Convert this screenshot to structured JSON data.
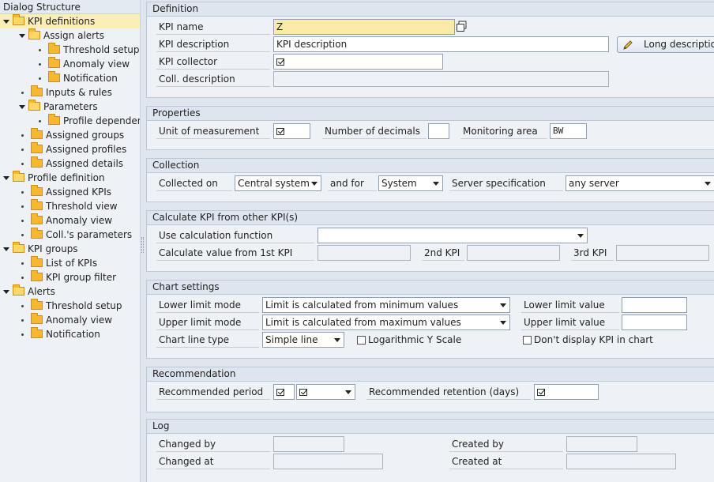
{
  "tree": {
    "title": "Dialog Structure",
    "nodes": [
      {
        "label": "KPI definitions",
        "type": "expanded",
        "level": 0,
        "selected": true
      },
      {
        "label": "Assign alerts",
        "type": "expanded",
        "level": 1
      },
      {
        "label": "Threshold setup",
        "type": "leaf",
        "level": 2
      },
      {
        "label": "Anomaly view",
        "type": "leaf",
        "level": 2
      },
      {
        "label": "Notification",
        "type": "leaf",
        "level": 2
      },
      {
        "label": "Inputs & rules",
        "type": "leaf",
        "level": 1
      },
      {
        "label": "Parameters",
        "type": "expanded",
        "level": 1
      },
      {
        "label": "Profile dependent",
        "type": "leaf",
        "level": 2
      },
      {
        "label": "Assigned groups",
        "type": "leaf",
        "level": 1
      },
      {
        "label": "Assigned profiles",
        "type": "leaf",
        "level": 1
      },
      {
        "label": "Assigned details",
        "type": "leaf",
        "level": 1
      },
      {
        "label": "Profile definition",
        "type": "expanded",
        "level": 0
      },
      {
        "label": "Assigned KPIs",
        "type": "leaf",
        "level": 1
      },
      {
        "label": "Threshold view",
        "type": "leaf",
        "level": 1
      },
      {
        "label": "Anomaly view",
        "type": "leaf",
        "level": 1
      },
      {
        "label": "Coll.'s parameters",
        "type": "leaf",
        "level": 1
      },
      {
        "label": "KPI groups",
        "type": "expanded",
        "level": 0
      },
      {
        "label": "List of KPIs",
        "type": "leaf",
        "level": 1
      },
      {
        "label": "KPI group filter",
        "type": "leaf",
        "level": 1
      },
      {
        "label": "Alerts",
        "type": "expanded",
        "level": 0
      },
      {
        "label": "Threshold setup",
        "type": "leaf",
        "level": 1
      },
      {
        "label": "Anomaly view",
        "type": "leaf",
        "level": 1
      },
      {
        "label": "Notification",
        "type": "leaf",
        "level": 1
      }
    ]
  },
  "definition": {
    "title": "Definition",
    "kpi_name_label": "KPI name",
    "kpi_name_value": "Z",
    "kpi_desc_label": "KPI description",
    "kpi_desc_value": "KPI description",
    "long_desc_button": "Long description",
    "collector_label": "KPI collector",
    "coll_desc_label": "Coll. description"
  },
  "properties": {
    "title": "Properties",
    "unit_label": "Unit of measurement",
    "decimals_label": "Number of decimals",
    "area_label": "Monitoring area",
    "area_value": "BW"
  },
  "collection": {
    "title": "Collection",
    "collected_on_label": "Collected on",
    "collected_on_value": "Central system",
    "and_for_label": "and for",
    "and_for_value": "System",
    "server_spec_label": "Server specification",
    "server_spec_value": "any server"
  },
  "calc": {
    "title": "Calculate KPI from other KPI(s)",
    "use_calc_label": "Use calculation function",
    "first_label": "Calculate value from 1st KPI",
    "second_label": "2nd KPI",
    "third_label": "3rd KPI"
  },
  "chart": {
    "title": "Chart settings",
    "lower_mode_label": "Lower limit mode",
    "lower_mode_value": "Limit is calculated from minimum values",
    "lower_value_label": "Lower limit value",
    "upper_mode_label": "Upper limit mode",
    "upper_mode_value": "Limit is calculated from maximum values",
    "upper_value_label": "Upper limit value",
    "line_type_label": "Chart line type",
    "line_type_value": "Simple line",
    "log_scale_label": "Logarithmic Y Scale",
    "no_display_label": "Don't display KPI in chart"
  },
  "recommendation": {
    "title": "Recommendation",
    "period_label": "Recommended period",
    "retention_label": "Recommended retention (days)"
  },
  "log": {
    "title": "Log",
    "changed_by_label": "Changed by",
    "changed_at_label": "Changed at",
    "created_by_label": "Created by",
    "created_at_label": "Created at"
  }
}
